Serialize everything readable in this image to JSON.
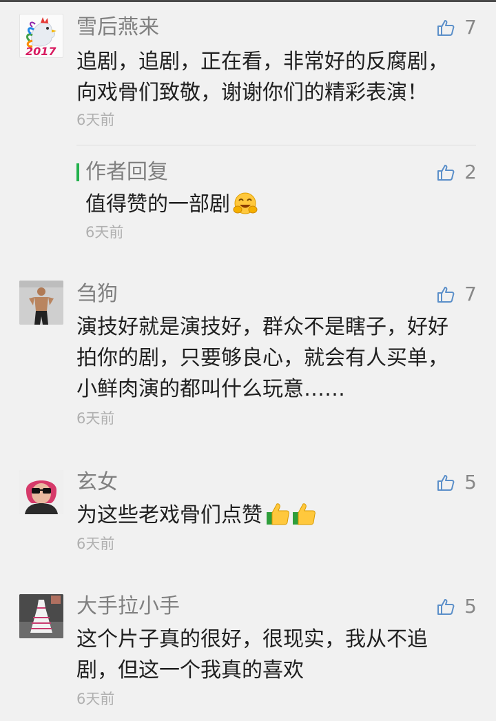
{
  "comments": [
    {
      "name": "雪后燕来",
      "likes": "7",
      "text": "追剧，追剧，正在看，非常好的反腐剧，\n向戏骨们致敬，谢谢你们的精彩表演！",
      "time": "6天前",
      "avatar": "rooster-2017-avatar",
      "avatar_text": "2017",
      "reply": {
        "label": "作者回复",
        "likes": "2",
        "text": "值得赞的一部剧",
        "emoji": "laughing-face-emoji",
        "time": "6天前"
      }
    },
    {
      "name": "刍狗",
      "likes": "7",
      "text": "演技好就是演技好，群众不是瞎子，好好\n拍你的剧，只要够良心，就会有人买单，\n小鲜肉演的都叫什么玩意……",
      "time": "6天前",
      "avatar": "man-photo-avatar"
    },
    {
      "name": "玄女",
      "likes": "5",
      "text": "为这些老戏骨们点赞",
      "emoji": "thumbs-up-emoji",
      "time": "6天前",
      "avatar": "woman-sunglasses-avatar"
    },
    {
      "name": "大手拉小手",
      "likes": "5",
      "text": "这个片子真的很好，很现实，我从不追\n剧，但这一个我真的喜欢",
      "time": "6天前",
      "avatar": "dress-photo-avatar"
    }
  ],
  "colors": {
    "background": "#f1f1f1",
    "name": "#808080",
    "text": "#202020",
    "time": "#b0b0b0",
    "like_icon": "#5b8fc9",
    "reply_accent": "#22b14c"
  }
}
